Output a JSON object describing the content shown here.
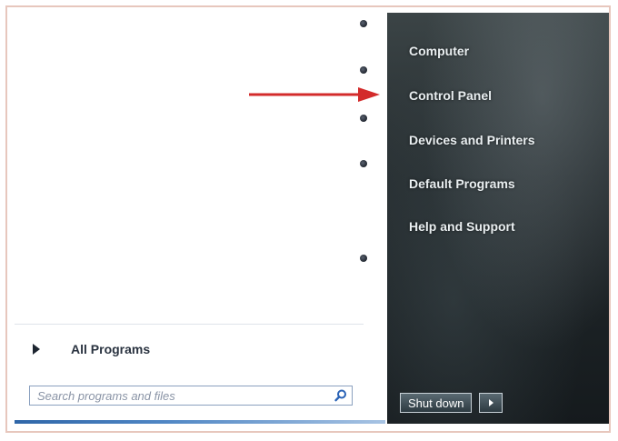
{
  "left_pane": {
    "all_programs_label": "All Programs",
    "search_placeholder": "Search programs and files"
  },
  "right_pane": {
    "items": [
      {
        "label": "Computer"
      },
      {
        "label": "Control Panel"
      },
      {
        "label": "Devices and Printers"
      },
      {
        "label": "Default Programs"
      },
      {
        "label": "Help and Support"
      }
    ],
    "shutdown_label": "Shut down"
  },
  "icons": {
    "search": "magnifier-icon",
    "annotation": "red-arrow-icon"
  },
  "colors": {
    "annotation_arrow": "#d32b2b",
    "right_pane_dark": "#1e2528"
  }
}
